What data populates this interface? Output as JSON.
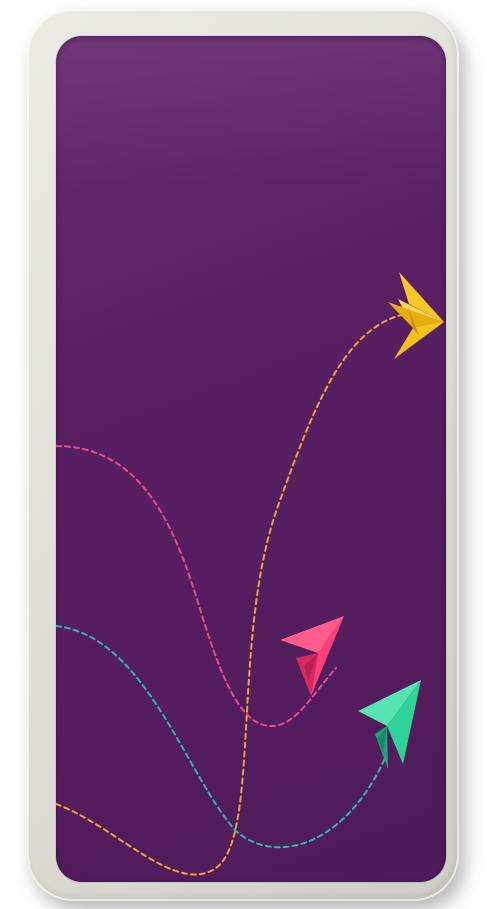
{
  "colors": {
    "frame": "#dddcd5",
    "screen": "#5a1f63",
    "plane_yellow": "#f4c21f",
    "plane_pink": "#ff3f7a",
    "plane_green": "#2fd39a",
    "trail_orange": "#e9a43a",
    "trail_pink": "#e64b8c",
    "trail_teal": "#35b3a8"
  },
  "illustration": {
    "planes": [
      {
        "name": "yellow-paper-plane-icon",
        "color": "plane_yellow"
      },
      {
        "name": "pink-paper-plane-icon",
        "color": "plane_pink"
      },
      {
        "name": "green-paper-plane-icon",
        "color": "plane_green"
      }
    ],
    "trails": [
      {
        "name": "orange-dashed-trail",
        "style": "dashed"
      },
      {
        "name": "pink-dashed-trail",
        "style": "dashed"
      },
      {
        "name": "teal-dashed-trail",
        "style": "dashed"
      }
    ]
  }
}
